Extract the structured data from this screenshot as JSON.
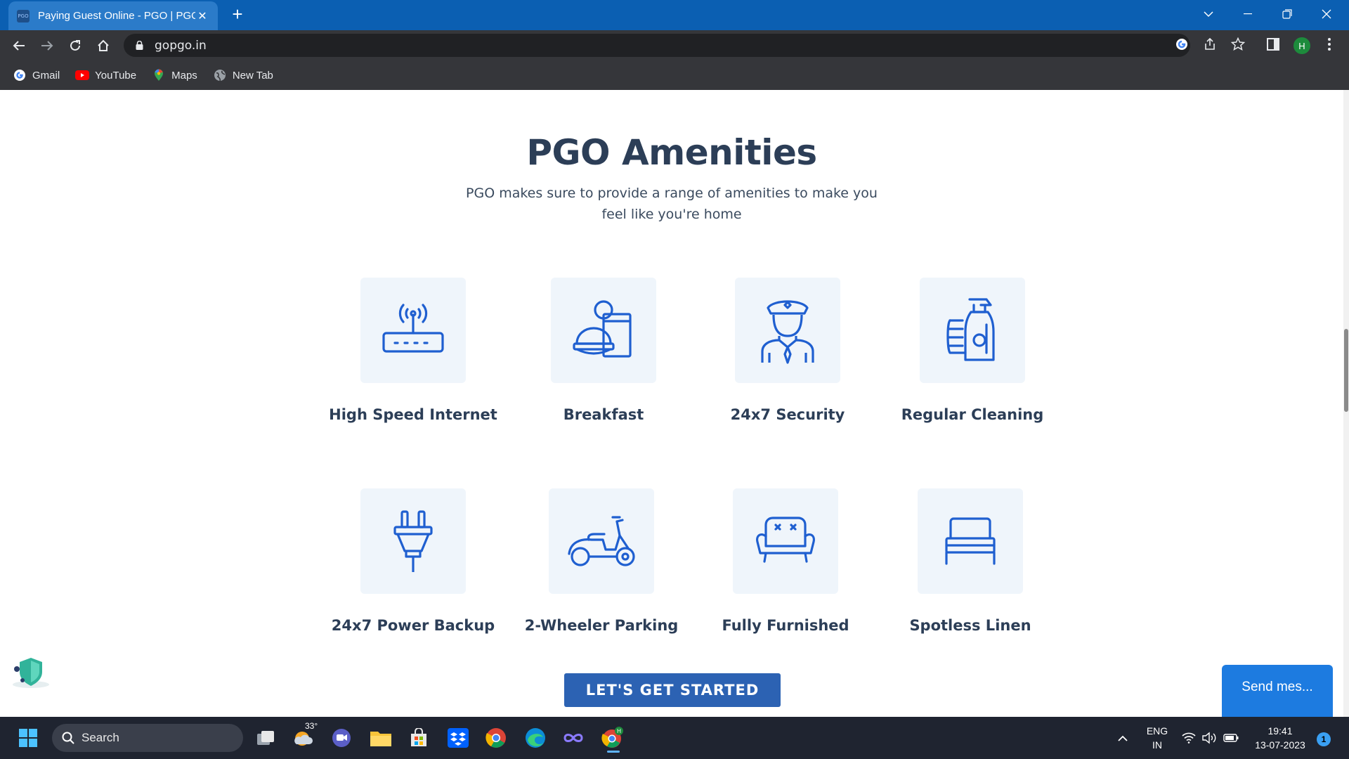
{
  "browser": {
    "tab_title": "Paying Guest Online - PGO | PGO",
    "tab_favicon_text": "PGO",
    "url": "gopgo.in",
    "profile_initial": "H",
    "bookmarks": [
      {
        "label": "Gmail",
        "icon": "google-icon"
      },
      {
        "label": "YouTube",
        "icon": "youtube-icon"
      },
      {
        "label": "Maps",
        "icon": "maps-icon"
      },
      {
        "label": "New Tab",
        "icon": "globe-icon"
      }
    ]
  },
  "page": {
    "heading": "PGO Amenities",
    "subtitle": "PGO makes sure to provide a range of amenities to make you feel like you're home",
    "amenities": [
      {
        "label": "High Speed Internet",
        "icon": "router-icon"
      },
      {
        "label": "Breakfast",
        "icon": "breakfast-icon"
      },
      {
        "label": "24x7 Security",
        "icon": "security-guard-icon"
      },
      {
        "label": "Regular Cleaning",
        "icon": "cleaning-spray-icon"
      },
      {
        "label": "24x7 Power Backup",
        "icon": "power-plug-icon"
      },
      {
        "label": "2-Wheeler Parking",
        "icon": "scooter-icon"
      },
      {
        "label": "Fully Furnished",
        "icon": "sofa-icon"
      },
      {
        "label": "Spotless Linen",
        "icon": "bed-icon"
      }
    ],
    "cta_label": "LET'S GET STARTED",
    "chat_label": "Send mes..."
  },
  "taskbar": {
    "search_label": "Search",
    "weather_temp": "33°",
    "language": "ENG",
    "region": "IN",
    "time": "19:41",
    "date": "13-07-2023",
    "notification_count": "1"
  },
  "colors": {
    "tabbar": "#0b5fb2",
    "heading": "#2c3e57",
    "icon_stroke": "#1f5fd0",
    "icon_box": "#eff5fb",
    "cta": "#2c62b3",
    "chat": "#1d7be0"
  }
}
